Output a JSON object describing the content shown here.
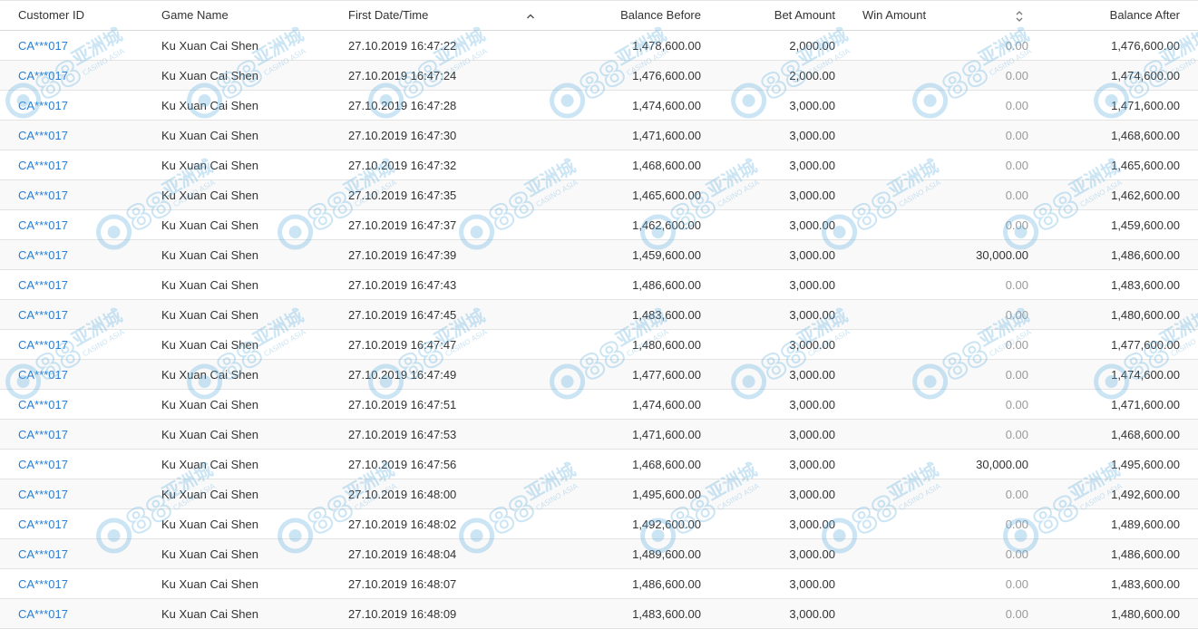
{
  "table": {
    "columns": {
      "customer_id": "Customer ID",
      "game_name": "Game Name",
      "first_datetime": "First Date/Time",
      "balance_before": "Balance Before",
      "bet_amount": "Bet Amount",
      "win_amount": "Win Amount",
      "balance_after": "Balance After"
    },
    "sort": {
      "first_datetime": "ascending",
      "win_amount": "unsorted"
    },
    "rows": [
      {
        "customer_id": "CA***017",
        "game_name": "Ku Xuan Cai Shen",
        "first_datetime": "27.10.2019 16:47:22",
        "balance_before": "1,478,600.00",
        "bet_amount": "2,000.00",
        "win_amount": "0.00",
        "balance_after": "1,476,600.00"
      },
      {
        "customer_id": "CA***017",
        "game_name": "Ku Xuan Cai Shen",
        "first_datetime": "27.10.2019 16:47:24",
        "balance_before": "1,476,600.00",
        "bet_amount": "2,000.00",
        "win_amount": "0.00",
        "balance_after": "1,474,600.00"
      },
      {
        "customer_id": "CA***017",
        "game_name": "Ku Xuan Cai Shen",
        "first_datetime": "27.10.2019 16:47:28",
        "balance_before": "1,474,600.00",
        "bet_amount": "3,000.00",
        "win_amount": "0.00",
        "balance_after": "1,471,600.00"
      },
      {
        "customer_id": "CA***017",
        "game_name": "Ku Xuan Cai Shen",
        "first_datetime": "27.10.2019 16:47:30",
        "balance_before": "1,471,600.00",
        "bet_amount": "3,000.00",
        "win_amount": "0.00",
        "balance_after": "1,468,600.00"
      },
      {
        "customer_id": "CA***017",
        "game_name": "Ku Xuan Cai Shen",
        "first_datetime": "27.10.2019 16:47:32",
        "balance_before": "1,468,600.00",
        "bet_amount": "3,000.00",
        "win_amount": "0.00",
        "balance_after": "1,465,600.00"
      },
      {
        "customer_id": "CA***017",
        "game_name": "Ku Xuan Cai Shen",
        "first_datetime": "27.10.2019 16:47:35",
        "balance_before": "1,465,600.00",
        "bet_amount": "3,000.00",
        "win_amount": "0.00",
        "balance_after": "1,462,600.00"
      },
      {
        "customer_id": "CA***017",
        "game_name": "Ku Xuan Cai Shen",
        "first_datetime": "27.10.2019 16:47:37",
        "balance_before": "1,462,600.00",
        "bet_amount": "3,000.00",
        "win_amount": "0.00",
        "balance_after": "1,459,600.00"
      },
      {
        "customer_id": "CA***017",
        "game_name": "Ku Xuan Cai Shen",
        "first_datetime": "27.10.2019 16:47:39",
        "balance_before": "1,459,600.00",
        "bet_amount": "3,000.00",
        "win_amount": "30,000.00",
        "balance_after": "1,486,600.00"
      },
      {
        "customer_id": "CA***017",
        "game_name": "Ku Xuan Cai Shen",
        "first_datetime": "27.10.2019 16:47:43",
        "balance_before": "1,486,600.00",
        "bet_amount": "3,000.00",
        "win_amount": "0.00",
        "balance_after": "1,483,600.00"
      },
      {
        "customer_id": "CA***017",
        "game_name": "Ku Xuan Cai Shen",
        "first_datetime": "27.10.2019 16:47:45",
        "balance_before": "1,483,600.00",
        "bet_amount": "3,000.00",
        "win_amount": "0.00",
        "balance_after": "1,480,600.00"
      },
      {
        "customer_id": "CA***017",
        "game_name": "Ku Xuan Cai Shen",
        "first_datetime": "27.10.2019 16:47:47",
        "balance_before": "1,480,600.00",
        "bet_amount": "3,000.00",
        "win_amount": "0.00",
        "balance_after": "1,477,600.00"
      },
      {
        "customer_id": "CA***017",
        "game_name": "Ku Xuan Cai Shen",
        "first_datetime": "27.10.2019 16:47:49",
        "balance_before": "1,477,600.00",
        "bet_amount": "3,000.00",
        "win_amount": "0.00",
        "balance_after": "1,474,600.00"
      },
      {
        "customer_id": "CA***017",
        "game_name": "Ku Xuan Cai Shen",
        "first_datetime": "27.10.2019 16:47:51",
        "balance_before": "1,474,600.00",
        "bet_amount": "3,000.00",
        "win_amount": "0.00",
        "balance_after": "1,471,600.00"
      },
      {
        "customer_id": "CA***017",
        "game_name": "Ku Xuan Cai Shen",
        "first_datetime": "27.10.2019 16:47:53",
        "balance_before": "1,471,600.00",
        "bet_amount": "3,000.00",
        "win_amount": "0.00",
        "balance_after": "1,468,600.00"
      },
      {
        "customer_id": "CA***017",
        "game_name": "Ku Xuan Cai Shen",
        "first_datetime": "27.10.2019 16:47:56",
        "balance_before": "1,468,600.00",
        "bet_amount": "3,000.00",
        "win_amount": "30,000.00",
        "balance_after": "1,495,600.00"
      },
      {
        "customer_id": "CA***017",
        "game_name": "Ku Xuan Cai Shen",
        "first_datetime": "27.10.2019 16:48:00",
        "balance_before": "1,495,600.00",
        "bet_amount": "3,000.00",
        "win_amount": "0.00",
        "balance_after": "1,492,600.00"
      },
      {
        "customer_id": "CA***017",
        "game_name": "Ku Xuan Cai Shen",
        "first_datetime": "27.10.2019 16:48:02",
        "balance_before": "1,492,600.00",
        "bet_amount": "3,000.00",
        "win_amount": "0.00",
        "balance_after": "1,489,600.00"
      },
      {
        "customer_id": "CA***017",
        "game_name": "Ku Xuan Cai Shen",
        "first_datetime": "27.10.2019 16:48:04",
        "balance_before": "1,489,600.00",
        "bet_amount": "3,000.00",
        "win_amount": "0.00",
        "balance_after": "1,486,600.00"
      },
      {
        "customer_id": "CA***017",
        "game_name": "Ku Xuan Cai Shen",
        "first_datetime": "27.10.2019 16:48:07",
        "balance_before": "1,486,600.00",
        "bet_amount": "3,000.00",
        "win_amount": "0.00",
        "balance_after": "1,483,600.00"
      },
      {
        "customer_id": "CA***017",
        "game_name": "Ku Xuan Cai Shen",
        "first_datetime": "27.10.2019 16:48:09",
        "balance_before": "1,483,600.00",
        "bet_amount": "3,000.00",
        "win_amount": "0.00",
        "balance_after": "1,480,600.00"
      }
    ]
  },
  "watermark": {
    "brand": "CA88",
    "chinese": "亚洲城",
    "tagline": "CASINO ASIA",
    "color": "#5fb0e0"
  },
  "colors": {
    "link": "#2a7fd4",
    "zero_value": "#9a9a9a",
    "row_alt": "#f9f9f9"
  },
  "icons": {
    "date_sort": "sort-ascending-icon",
    "win_sort": "sort-both-icon"
  }
}
